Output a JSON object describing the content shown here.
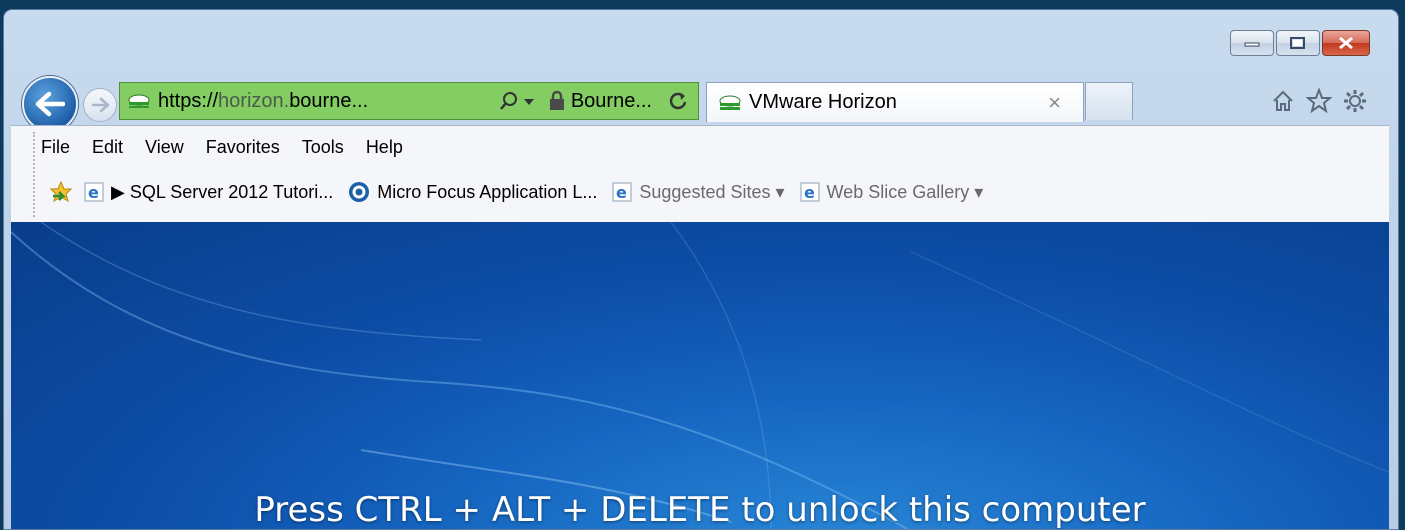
{
  "window": {
    "caption_buttons": [
      "minimize-icon",
      "maximize-icon",
      "close-icon"
    ]
  },
  "address_bar": {
    "url_prefix": "https://",
    "url_host_dim": "horizon.",
    "url_host_bold": "bourne...",
    "site_identity": "Bourne...",
    "background_color": "#83cd63"
  },
  "tab": {
    "title": "VMware Horizon",
    "close": "×"
  },
  "menu": {
    "items": [
      "File",
      "Edit",
      "View",
      "Favorites",
      "Tools",
      "Help"
    ]
  },
  "favorites_bar": {
    "items": [
      {
        "label": "▶ SQL Server 2012 Tutori...",
        "icon": "ie-icon"
      },
      {
        "label": "Micro Focus Application L...",
        "icon": "microfocus-icon"
      },
      {
        "label": "Suggested Sites ▾",
        "icon": "ie-icon"
      },
      {
        "label": "Web Slice Gallery ▾",
        "icon": "ie-icon"
      }
    ]
  },
  "content": {
    "lock_message": "Press CTRL + ALT + DELETE to unlock this computer"
  }
}
